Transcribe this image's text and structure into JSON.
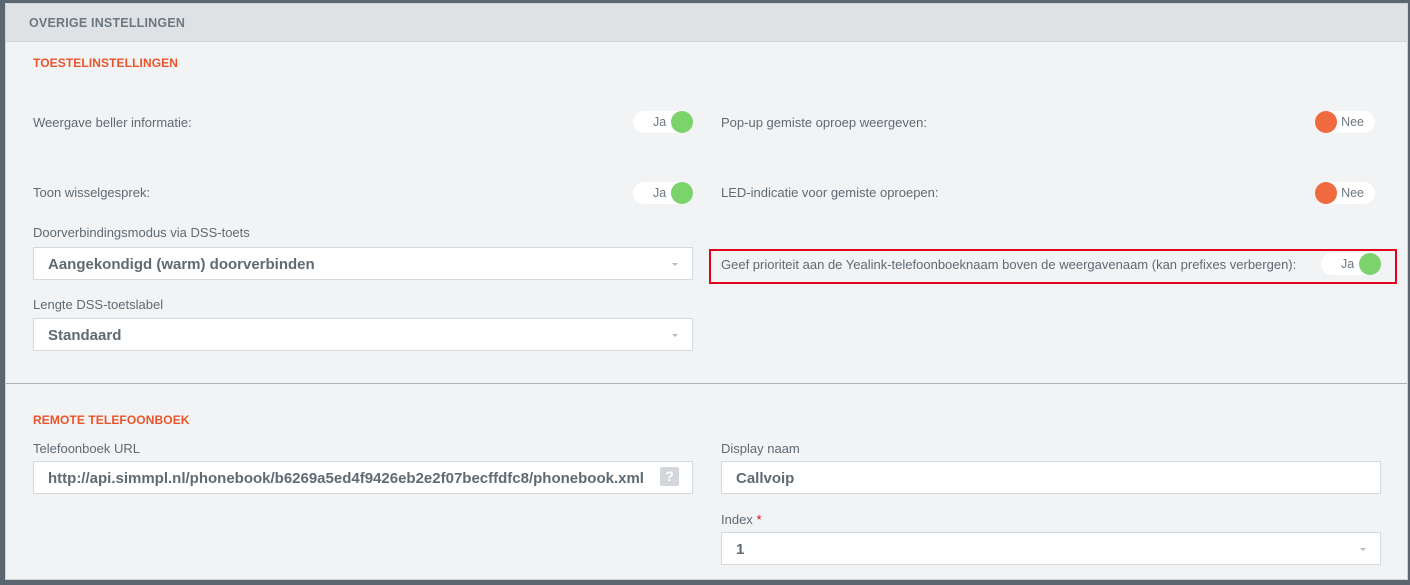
{
  "panel": {
    "title": "OVERIGE INSTELLINGEN"
  },
  "device_settings": {
    "title": "TOESTELINSTELLINGEN",
    "caller_info": {
      "label": "Weergave beller informatie:",
      "state": "Ja"
    },
    "missed_popup": {
      "label": "Pop-up gemiste oproep weergeven:",
      "state": "Nee"
    },
    "call_waiting": {
      "label": "Toon wisselgesprek:",
      "state": "Ja"
    },
    "led_missed": {
      "label": "LED-indicatie voor gemiste oproepen:",
      "state": "Nee"
    },
    "transfer_mode": {
      "label": "Doorverbindingsmodus via DSS-toets",
      "value": "Aangekondigd (warm) doorverbinden"
    },
    "yealink_priority": {
      "label": "Geef prioriteit aan de Yealink-telefoonboeknaam boven de weergavenaam (kan prefixes verbergen):",
      "state": "Ja"
    },
    "dss_label_length": {
      "label": "Lengte DSS-toetslabel",
      "value": "Standaard"
    }
  },
  "remote_phonebook": {
    "title": "REMOTE TELEFOONBOEK",
    "url": {
      "label": "Telefoonboek URL",
      "value": "http://api.simmpl.nl/phonebook/b6269a5ed4f9426eb2e2f07becffdfc8/phonebook.xml",
      "help": "?"
    },
    "display_name": {
      "label": "Display naam",
      "value": "Callvoip"
    },
    "index": {
      "label": "Index",
      "required": "*",
      "value": "1"
    }
  },
  "colors": {
    "accent": "#e8552b",
    "on": "#7dd36b",
    "off": "#ef6a3e",
    "highlight": "#e3001b"
  }
}
